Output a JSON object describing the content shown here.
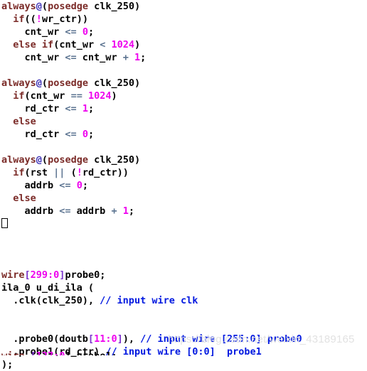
{
  "editor": {
    "language": "verilog",
    "background_color": "#ffffff",
    "font_size_px": 13.5,
    "line_height_px": 18,
    "colors": {
      "keyword": "#7b2b28",
      "identifier": "#000000",
      "number": "#ee00ee",
      "bracket": "#7a33cc",
      "operator": "#5b7390",
      "at_sign": "#3b2fb5",
      "comment": "#0018e0",
      "watermark": "#e2e2e2"
    }
  },
  "code": {
    "lines": [
      {
        "id": "line-1",
        "text": "always@(posedge clk_250)",
        "tokens": [
          {
            "t": "always",
            "c": "t-kw"
          },
          {
            "t": "@",
            "c": "t-at"
          },
          {
            "t": "(",
            "c": "t-punct"
          },
          {
            "t": "posedge",
            "c": "t-kw"
          },
          {
            "t": " clk_250)",
            "c": "t-plain"
          }
        ]
      },
      {
        "id": "line-2",
        "text": "  if((!wr_ctr))",
        "tokens": [
          {
            "t": "  ",
            "c": "t-plain"
          },
          {
            "t": "if",
            "c": "t-kw"
          },
          {
            "t": "((",
            "c": "t-punct"
          },
          {
            "t": "!",
            "c": "t-bang"
          },
          {
            "t": "wr_ctr))",
            "c": "t-plain"
          }
        ]
      },
      {
        "id": "line-3",
        "text": "    cnt_wr <= 0;",
        "tokens": [
          {
            "t": "    cnt_wr ",
            "c": "t-plain"
          },
          {
            "t": "<=",
            "c": "t-op"
          },
          {
            "t": " ",
            "c": "t-plain"
          },
          {
            "t": "0",
            "c": "t-num"
          },
          {
            "t": ";",
            "c": "t-punct"
          }
        ]
      },
      {
        "id": "line-4",
        "text": "  else if(cnt_wr < 1024)",
        "tokens": [
          {
            "t": "  ",
            "c": "t-plain"
          },
          {
            "t": "else",
            "c": "t-kw"
          },
          {
            "t": " ",
            "c": "t-plain"
          },
          {
            "t": "if",
            "c": "t-kw"
          },
          {
            "t": "(cnt_wr ",
            "c": "t-plain"
          },
          {
            "t": "<",
            "c": "t-op"
          },
          {
            "t": " ",
            "c": "t-plain"
          },
          {
            "t": "1024",
            "c": "t-num"
          },
          {
            "t": ")",
            "c": "t-punct"
          }
        ]
      },
      {
        "id": "line-5",
        "text": "    cnt_wr <= cnt_wr + 1;",
        "tokens": [
          {
            "t": "    cnt_wr ",
            "c": "t-plain"
          },
          {
            "t": "<=",
            "c": "t-op"
          },
          {
            "t": " cnt_wr ",
            "c": "t-plain"
          },
          {
            "t": "+",
            "c": "t-op"
          },
          {
            "t": " ",
            "c": "t-plain"
          },
          {
            "t": "1",
            "c": "t-num"
          },
          {
            "t": ";",
            "c": "t-punct"
          }
        ]
      },
      {
        "id": "line-6",
        "text": "",
        "tokens": []
      },
      {
        "id": "line-7",
        "text": "always@(posedge clk_250)",
        "tokens": [
          {
            "t": "always",
            "c": "t-kw"
          },
          {
            "t": "@",
            "c": "t-at"
          },
          {
            "t": "(",
            "c": "t-punct"
          },
          {
            "t": "posedge",
            "c": "t-kw"
          },
          {
            "t": " clk_250)",
            "c": "t-plain"
          }
        ]
      },
      {
        "id": "line-8",
        "text": "  if(cnt_wr == 1024)",
        "tokens": [
          {
            "t": "  ",
            "c": "t-plain"
          },
          {
            "t": "if",
            "c": "t-kw"
          },
          {
            "t": "(cnt_wr ",
            "c": "t-plain"
          },
          {
            "t": "==",
            "c": "t-op"
          },
          {
            "t": " ",
            "c": "t-plain"
          },
          {
            "t": "1024",
            "c": "t-num"
          },
          {
            "t": ")",
            "c": "t-punct"
          }
        ]
      },
      {
        "id": "line-9",
        "text": "    rd_ctr <= 1;",
        "tokens": [
          {
            "t": "    rd_ctr ",
            "c": "t-plain"
          },
          {
            "t": "<=",
            "c": "t-op"
          },
          {
            "t": " ",
            "c": "t-plain"
          },
          {
            "t": "1",
            "c": "t-num"
          },
          {
            "t": ";",
            "c": "t-punct"
          }
        ]
      },
      {
        "id": "line-10",
        "text": "  else",
        "tokens": [
          {
            "t": "  ",
            "c": "t-plain"
          },
          {
            "t": "else",
            "c": "t-kw"
          }
        ]
      },
      {
        "id": "line-11",
        "text": "    rd_ctr <= 0;",
        "tokens": [
          {
            "t": "    rd_ctr ",
            "c": "t-plain"
          },
          {
            "t": "<=",
            "c": "t-op"
          },
          {
            "t": " ",
            "c": "t-plain"
          },
          {
            "t": "0",
            "c": "t-num"
          },
          {
            "t": ";",
            "c": "t-punct"
          }
        ]
      },
      {
        "id": "line-12",
        "text": "",
        "tokens": []
      },
      {
        "id": "line-13",
        "text": "always@(posedge clk_250)",
        "tokens": [
          {
            "t": "always",
            "c": "t-kw"
          },
          {
            "t": "@",
            "c": "t-at"
          },
          {
            "t": "(",
            "c": "t-punct"
          },
          {
            "t": "posedge",
            "c": "t-kw"
          },
          {
            "t": " clk_250)",
            "c": "t-plain"
          }
        ]
      },
      {
        "id": "line-14",
        "text": "  if(rst || (!rd_ctr))",
        "tokens": [
          {
            "t": "  ",
            "c": "t-plain"
          },
          {
            "t": "if",
            "c": "t-kw"
          },
          {
            "t": "(rst ",
            "c": "t-plain"
          },
          {
            "t": "||",
            "c": "t-op"
          },
          {
            "t": " (",
            "c": "t-plain"
          },
          {
            "t": "!",
            "c": "t-bang"
          },
          {
            "t": "rd_ctr))",
            "c": "t-plain"
          }
        ]
      },
      {
        "id": "line-15",
        "text": "    addrb <= 0;",
        "tokens": [
          {
            "t": "    addrb ",
            "c": "t-plain"
          },
          {
            "t": "<=",
            "c": "t-op"
          },
          {
            "t": " ",
            "c": "t-plain"
          },
          {
            "t": "0",
            "c": "t-num"
          },
          {
            "t": ";",
            "c": "t-punct"
          }
        ]
      },
      {
        "id": "line-16",
        "text": "  else",
        "tokens": [
          {
            "t": "  ",
            "c": "t-plain"
          },
          {
            "t": "else",
            "c": "t-kw"
          }
        ]
      },
      {
        "id": "line-17",
        "text": "    addrb <= addrb + 1;",
        "tokens": [
          {
            "t": "    addrb ",
            "c": "t-plain"
          },
          {
            "t": "<=",
            "c": "t-op"
          },
          {
            "t": " addrb ",
            "c": "t-plain"
          },
          {
            "t": "+",
            "c": "t-op"
          },
          {
            "t": " ",
            "c": "t-plain"
          },
          {
            "t": "1",
            "c": "t-num"
          },
          {
            "t": ";",
            "c": "t-punct"
          }
        ]
      },
      {
        "id": "line-18",
        "text": "□",
        "tokens": [
          {
            "t": "□",
            "c": "t-tofu"
          }
        ],
        "is_tofu": true
      },
      {
        "id": "line-19",
        "text": "",
        "tokens": []
      },
      {
        "id": "line-20",
        "text": "",
        "tokens": []
      },
      {
        "id": "line-21",
        "text": "",
        "tokens": []
      },
      {
        "id": "line-22",
        "text": "wire[299:0]probe0;",
        "tokens": [
          {
            "t": "wire",
            "c": "t-kw"
          },
          {
            "t": "[",
            "c": "t-bracket"
          },
          {
            "t": "299:0",
            "c": "t-num"
          },
          {
            "t": "]",
            "c": "t-bracket"
          },
          {
            "t": "probe0;",
            "c": "t-plain"
          }
        ]
      },
      {
        "id": "line-23",
        "text": "ila_0 u_di_ila (",
        "tokens": [
          {
            "t": "ila_0 u_di_ila (",
            "c": "t-plain"
          }
        ]
      },
      {
        "id": "line-24",
        "text": "  .clk(clk_250), // input wire clk",
        "tokens": [
          {
            "t": "  .clk(clk_250), ",
            "c": "t-plain"
          },
          {
            "t": "// input wire clk",
            "c": "t-comment"
          }
        ]
      },
      {
        "id": "line-25",
        "text": "",
        "tokens": []
      },
      {
        "id": "line-26",
        "text": "",
        "tokens": []
      },
      {
        "id": "line-27",
        "text": "  .probe0(doutb[11:0]), // input wire [255:0] probe0",
        "tokens": [
          {
            "t": "  .probe0(doutb",
            "c": "t-plain"
          },
          {
            "t": "[",
            "c": "t-bracket"
          },
          {
            "t": "11:0",
            "c": "t-num"
          },
          {
            "t": "]",
            "c": "t-bracket"
          },
          {
            "t": "), ",
            "c": "t-plain"
          },
          {
            "t": "// input wire [255:0] probe0",
            "c": "t-comment"
          }
        ]
      },
      {
        "id": "line-28",
        "text": "  .probe1(rd_ctr) // input wire [0:0]  probe1",
        "tokens": [
          {
            "t": "  .probe1(rd_ctr) ",
            "c": "t-plain"
          },
          {
            "t": "// input wire [0:0]  probe1",
            "c": "t-comment"
          }
        ]
      },
      {
        "id": "line-29",
        "text": ");",
        "tokens": [
          {
            "t": ");",
            "c": "t-plain"
          }
        ]
      }
    ],
    "clipped_bottom_line": {
      "id": "line-30",
      "text": "wire [127:0] probe1;",
      "tokens": [
        {
          "t": "wire",
          "c": "t-kw"
        },
        {
          "t": " [",
          "c": "t-bracket"
        },
        {
          "t": "127:0",
          "c": "t-num"
        },
        {
          "t": "] probe1;",
          "c": "t-plain"
        }
      ]
    }
  },
  "watermark": {
    "text": "https://blog.csdn.net/weixin_43189165"
  }
}
